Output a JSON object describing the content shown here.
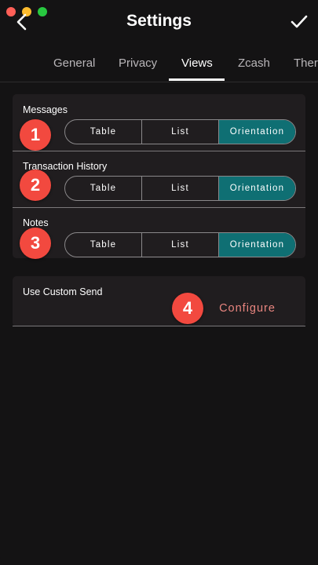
{
  "header": {
    "title": "Settings",
    "back_icon": "chevron-left-icon",
    "confirm_icon": "checkmark-icon"
  },
  "tabs": [
    {
      "label": "General",
      "active": false
    },
    {
      "label": "Privacy",
      "active": false
    },
    {
      "label": "Views",
      "active": true
    },
    {
      "label": "Zcash",
      "active": false
    },
    {
      "label": "Ther",
      "active": false
    }
  ],
  "views": {
    "rows": [
      {
        "label": "Messages",
        "badge": "1",
        "options": [
          "Table",
          "List",
          "Orientation"
        ],
        "selected": "Orientation"
      },
      {
        "label": "Transaction History",
        "badge": "2",
        "options": [
          "Table",
          "List",
          "Orientation"
        ],
        "selected": "Orientation"
      },
      {
        "label": "Notes",
        "badge": "3",
        "options": [
          "Table",
          "List",
          "Orientation"
        ],
        "selected": "Orientation"
      }
    ]
  },
  "custom_send": {
    "label": "Use Custom Send",
    "badge": "4",
    "button_label": "Configure"
  },
  "colors": {
    "background": "#141314",
    "panel": "#201d1f",
    "selected_segment": "#0f6f73",
    "badge": "#f2493f",
    "configure_text": "#e8857f"
  }
}
